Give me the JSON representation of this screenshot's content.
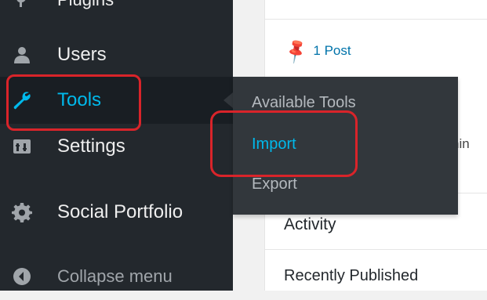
{
  "sidebar": {
    "items": [
      {
        "label": "Plugins",
        "icon": "plug-icon"
      },
      {
        "label": "Users",
        "icon": "users-icon"
      },
      {
        "label": "Tools",
        "icon": "wrench-icon"
      },
      {
        "label": "Settings",
        "icon": "settings-icon"
      },
      {
        "label": "Social Portfolio",
        "icon": "gear-icon"
      },
      {
        "label": "Collapse menu",
        "icon": "collapse-icon"
      }
    ]
  },
  "submenu": {
    "items": [
      {
        "label": "Available Tools"
      },
      {
        "label": "Import"
      },
      {
        "label": "Export"
      }
    ]
  },
  "content": {
    "post_count": "1 Post",
    "partial_text": "nin",
    "activity_title": "Activity",
    "recently_published": "Recently Published"
  },
  "colors": {
    "sidebar_bg": "#23282d",
    "active_accent": "#00b9eb",
    "highlight": "#d9242a"
  }
}
